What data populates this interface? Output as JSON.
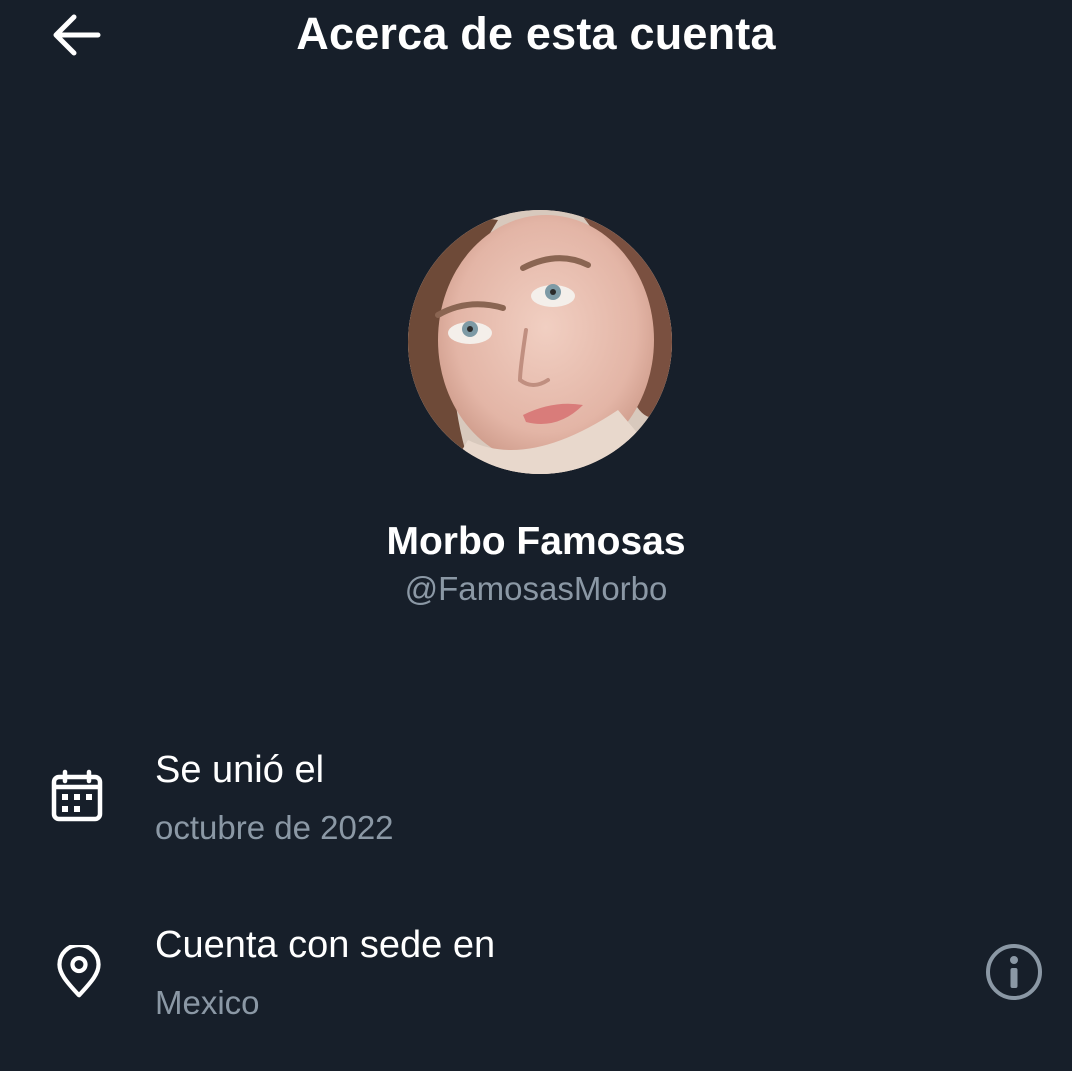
{
  "header": {
    "title": "Acerca de esta cuenta",
    "back_icon": "arrow-left-icon"
  },
  "profile": {
    "display_name": "Morbo Famosas",
    "handle": "@FamosasMorbo",
    "avatar_icon": "profile-photo"
  },
  "details": {
    "joined": {
      "icon": "calendar-icon",
      "label": "Se unió el",
      "value": "octubre de 2022"
    },
    "location": {
      "icon": "location-pin-icon",
      "label": "Cuenta con sede en",
      "value": "Mexico",
      "info_icon": "info-icon"
    }
  },
  "colors": {
    "background": "#171f2a",
    "primary_text": "#ffffff",
    "secondary_text": "#8b98a5"
  }
}
